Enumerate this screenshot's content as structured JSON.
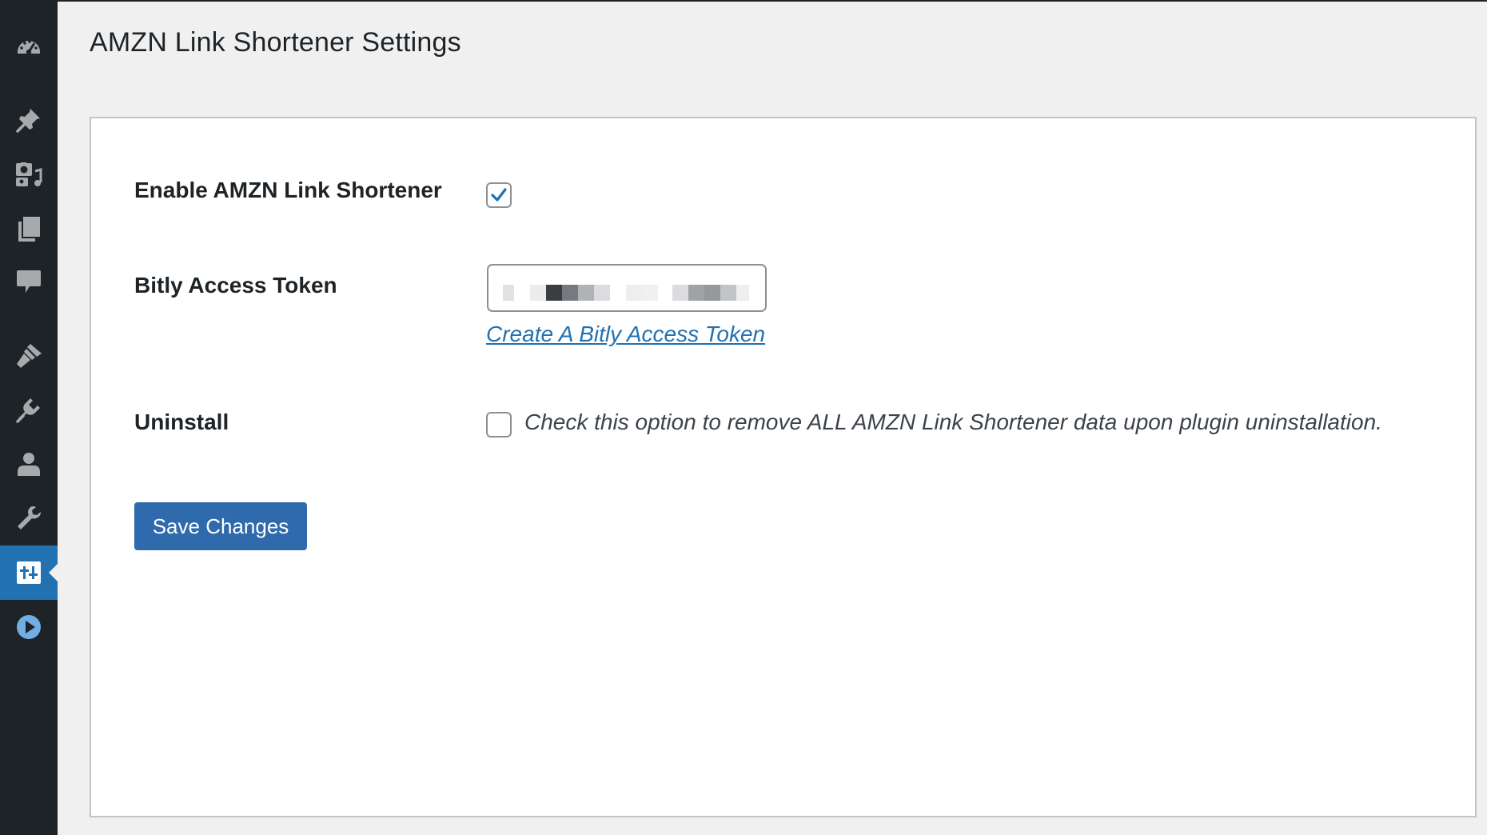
{
  "page": {
    "title": "AMZN Link Shortener Settings"
  },
  "sidebar": {
    "icons": [
      "dashboard-icon",
      "posts-pin-icon",
      "media-icon",
      "pages-icon",
      "comments-icon",
      "appearance-brush-icon",
      "plugins-icon",
      "users-icon",
      "tools-wrench-icon",
      "settings-sliders-icon",
      "play-circle-icon"
    ],
    "active": "settings-sliders-icon"
  },
  "settings": {
    "enable_label": "Enable AMZN Link Shortener",
    "enable_checked": true,
    "token_label": "Bitly Access Token",
    "token_value_obscured": true,
    "token_link": "Create A Bitly Access Token",
    "uninstall_label": "Uninstall",
    "uninstall_checked": false,
    "uninstall_description": "Check this option to remove ALL AMZN Link Shortener data upon plugin uninstallation."
  },
  "actions": {
    "save_label": "Save Changes"
  },
  "colors": {
    "sidebar_bg": "#1d2327",
    "sidebar_icon": "#a7aaad",
    "accent": "#2271b1",
    "button": "#2f6aad",
    "page_bg": "#f0f0f1"
  }
}
